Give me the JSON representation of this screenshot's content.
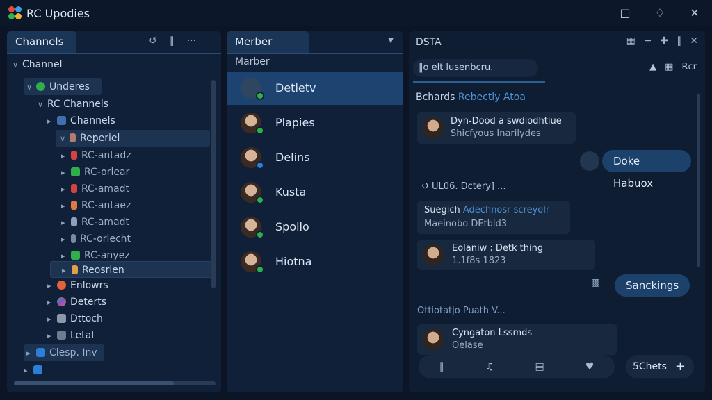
{
  "app": {
    "title": "RC Upodies"
  },
  "titlebar": {
    "icons": [
      "folder-icon",
      "bell-icon",
      "close-icon"
    ]
  },
  "left": {
    "tab": "Channels",
    "tree": [
      {
        "label": "Channel",
        "chev": "v"
      },
      {
        "label": "Underes",
        "chev": "v"
      },
      {
        "label": "RC Channels",
        "chev": "v"
      },
      {
        "label": "Channels",
        "chev": ">"
      },
      {
        "label": "Reperiel",
        "chev": "v"
      },
      {
        "label": "RC-antadz",
        "chev": ">"
      },
      {
        "label": "RC-orlear",
        "chev": ">"
      },
      {
        "label": "RC-amadt",
        "chev": ">"
      },
      {
        "label": "RC-antaez",
        "chev": ">"
      },
      {
        "label": "RC-amadt",
        "chev": ">"
      },
      {
        "label": "RC-orlecht",
        "chev": ">"
      },
      {
        "label": "RC-anyez",
        "chev": ">"
      },
      {
        "label": "Reosrien",
        "chev": ">"
      },
      {
        "label": "Enlowrs",
        "chev": ">"
      },
      {
        "label": "Deterts",
        "chev": ">"
      },
      {
        "label": "Dttoch",
        "chev": ">"
      },
      {
        "label": "Letal",
        "chev": ">"
      },
      {
        "label": "Clesp. Inv",
        "chev": ">"
      }
    ]
  },
  "mid": {
    "tab": "Merber",
    "subheader": "Marber",
    "members": [
      "Detietv",
      "Plapies",
      "Delins",
      "Kusta",
      "Spollo",
      "Hiotna"
    ]
  },
  "right": {
    "tab": "DSTA",
    "search": "‖o elt lusenbcru.",
    "topRight": "Rcr",
    "section1": {
      "name": "Bchards",
      "sub": "Rebectly Atoa"
    },
    "msg1": {
      "line1": "Dyn-Dood a swdiodhtiue",
      "line2": "Shicfyous Inarilydes"
    },
    "pill1": "Doke Habuox",
    "divider": "UL06. Dctery]  ...",
    "msg2": {
      "title": "Suegich",
      "titleBlue": "Adechnosr screyolr",
      "line2": "Maeinobo DEtbld3"
    },
    "msg3": {
      "line1": "Eolaniw : Detk thing",
      "line2": "1.1f8s 1823"
    },
    "pill2": "Sanckings",
    "section2": "Ottiotatjo Puath  V...",
    "msg4": {
      "line1": "Cyngaton Lssmds",
      "line2": "Oelase"
    },
    "composer": {
      "send": "5Chets"
    }
  }
}
